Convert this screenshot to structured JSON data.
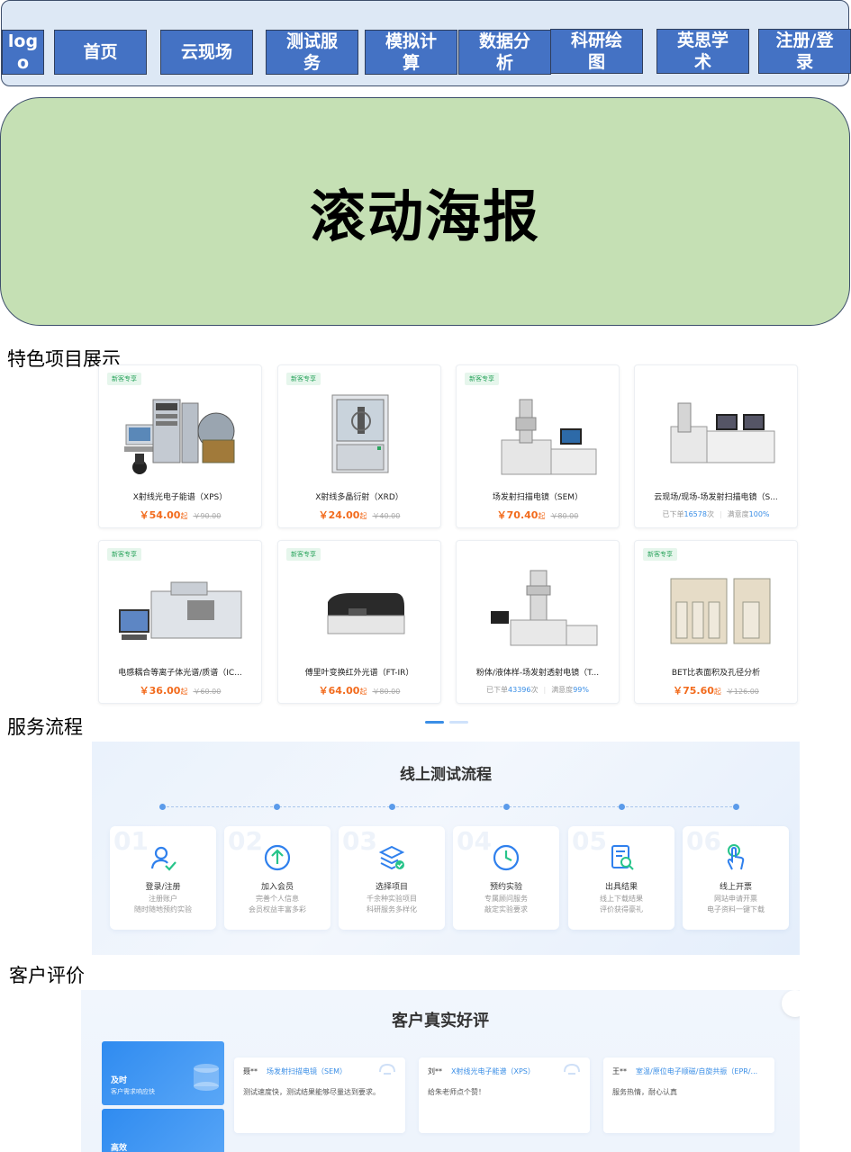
{
  "nav": {
    "items": [
      {
        "line1": "log",
        "line2": "o"
      },
      {
        "line1": "首页",
        "line2": ""
      },
      {
        "line1": "云现场",
        "line2": ""
      },
      {
        "line1": "测试服",
        "line2": "务"
      },
      {
        "line1": "模拟计",
        "line2": "算"
      },
      {
        "line1": "数据分",
        "line2": "析"
      },
      {
        "line1": "科研绘",
        "line2": "图"
      },
      {
        "line1": "英思学",
        "line2": "术"
      },
      {
        "line1": "注册/登",
        "line2": "录"
      }
    ]
  },
  "banner": {
    "title": "滚动海报"
  },
  "sections": {
    "featured": "特色项目展示",
    "process": "服务流程",
    "reviews": "客户评价"
  },
  "products": [
    {
      "tag": "新客专享",
      "name": "X射线光电子能谱（XPS）",
      "price": "￥54.00",
      "suffix": "起",
      "old": "￥90.00",
      "icon": "xps-instrument-image"
    },
    {
      "tag": "新客专享",
      "name": "X射线多晶衍射（XRD）",
      "price": "￥24.00",
      "suffix": "起",
      "old": "￥40.00",
      "icon": "xrd-instrument-image"
    },
    {
      "tag": "新客专享",
      "name": "场发射扫描电镜（SEM）",
      "price": "￥70.40",
      "suffix": "起",
      "old": "￥80.00",
      "icon": "sem-instrument-image"
    },
    {
      "tag": "",
      "name": "云现场/现场-场发射扫描电镜（S...",
      "orders_prefix": "已下单",
      "orders": "16578",
      "orders_suffix": "次",
      "sat_prefix": "满意度",
      "sat": "100%",
      "icon": "sem-workstation-image"
    },
    {
      "tag": "新客专享",
      "name": "电感耦合等离子体光谱/质谱（IC...",
      "price": "￥36.00",
      "suffix": "起",
      "old": "￥60.00",
      "icon": "icp-instrument-image"
    },
    {
      "tag": "新客专享",
      "name": "傅里叶变换红外光谱（FT-IR）",
      "price": "￥64.00",
      "suffix": "起",
      "old": "￥80.00",
      "icon": "ftir-instrument-image"
    },
    {
      "tag": "",
      "name": "粉体/液体样-场发射透射电镜（T...",
      "orders_prefix": "已下单",
      "orders": "43396",
      "orders_suffix": "次",
      "sat_prefix": "满意度",
      "sat": "99%",
      "icon": "tem-instrument-image"
    },
    {
      "tag": "新客专享",
      "name": "BET比表面积及孔径分析",
      "price": "￥75.60",
      "suffix": "起",
      "old": "￥126.00",
      "icon": "bet-instrument-image"
    }
  ],
  "process": {
    "title": "线上测试流程",
    "steps": [
      {
        "num": "01",
        "name": "登录/注册",
        "desc1": "注册账户",
        "desc2": "随时随地预约实验",
        "icon": "user-check-icon"
      },
      {
        "num": "02",
        "name": "加入会员",
        "desc1": "完善个人信息",
        "desc2": "会员权益丰富多彩",
        "icon": "arrow-up-circle-icon"
      },
      {
        "num": "03",
        "name": "选择项目",
        "desc1": "千余种实验项目",
        "desc2": "科研服务多样化",
        "icon": "layers-check-icon"
      },
      {
        "num": "04",
        "name": "预约实验",
        "desc1": "专属顾问服务",
        "desc2": "敲定实验要求",
        "icon": "clock-icon"
      },
      {
        "num": "05",
        "name": "出具结果",
        "desc1": "线上下载结果",
        "desc2": "评价获得豪礼",
        "icon": "document-search-icon"
      },
      {
        "num": "06",
        "name": "线上开票",
        "desc1": "网站申请开票",
        "desc2": "电子资料一键下载",
        "icon": "hand-tap-icon"
      }
    ]
  },
  "reviews": {
    "title": "客户真实好评",
    "tabs": [
      {
        "title": "及时",
        "desc": "客户需求响应快"
      },
      {
        "title": "高效",
        "desc": ""
      }
    ],
    "cards": [
      {
        "user": "聂**",
        "product": "场发射扫描电镜（SEM）",
        "text": "测试速度快，测试结果能够尽量达到要求。"
      },
      {
        "user": "刘**",
        "product": "X射线光电子能谱（XPS）",
        "text": "给朱老师点个赞！"
      },
      {
        "user": "王**",
        "product": "室温/原位电子顺磁/自旋共振（EPR/...",
        "text": "服务热情，耐心认真"
      }
    ]
  },
  "colors": {
    "nav_button": "#4472c4",
    "banner": "#c5e0b4",
    "price": "#f26b1d",
    "accent": "#3a8ee6",
    "tag_green": "#2aa45d"
  }
}
